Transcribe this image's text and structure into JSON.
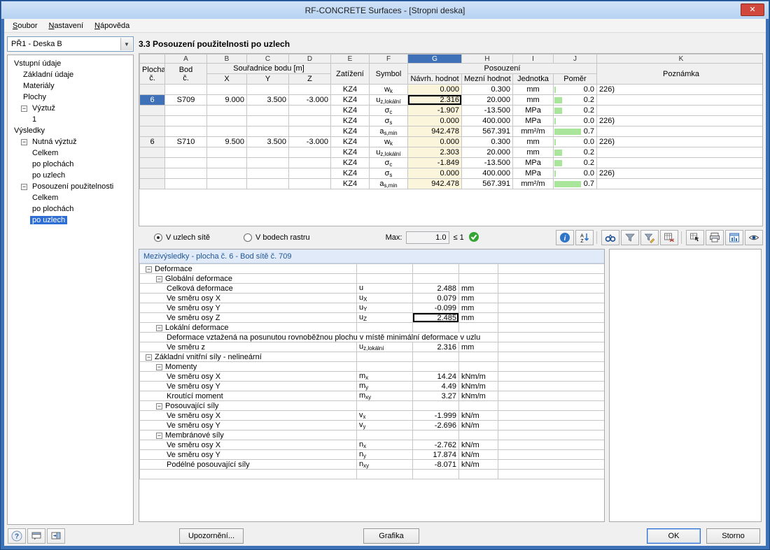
{
  "window": {
    "title": "RF-CONCRETE Surfaces - [Stropni deska]",
    "close_glyph": "✕"
  },
  "menu": {
    "items": [
      "Soubor",
      "Nastavení",
      "Nápověda"
    ]
  },
  "sidebar": {
    "combo_value": "PŘ1 - Deska B",
    "tree": [
      {
        "label": "Vstupní údaje",
        "indent": 0
      },
      {
        "label": "Základní údaje",
        "indent": 1
      },
      {
        "label": "Materiály",
        "indent": 1
      },
      {
        "label": "Plochy",
        "indent": 1
      },
      {
        "label": "Výztuž",
        "indent": 1,
        "exp": true
      },
      {
        "label": "1",
        "indent": 2
      },
      {
        "label": "Výsledky",
        "indent": 0
      },
      {
        "label": "Nutná výztuž",
        "indent": 1,
        "exp": true
      },
      {
        "label": "Celkem",
        "indent": 2
      },
      {
        "label": "po plochách",
        "indent": 2
      },
      {
        "label": "po uzlech",
        "indent": 2
      },
      {
        "label": "Posouzení použitelnosti",
        "indent": 1,
        "exp": true
      },
      {
        "label": "Celkem",
        "indent": 2
      },
      {
        "label": "po plochách",
        "indent": 2
      },
      {
        "label": "po uzlech",
        "indent": 2,
        "selected": true
      }
    ]
  },
  "main": {
    "section_title": "3.3 Posouzení použitelnosti po uzlech",
    "table": {
      "letters": [
        "A",
        "B",
        "C",
        "D",
        "E",
        "F",
        "G",
        "H",
        "I",
        "J",
        "K"
      ],
      "h": {
        "plocha1": "Plocha",
        "plocha2": "č.",
        "bod1": "Bod",
        "bod2": "č.",
        "coords": "Souřadnice bodu [m]",
        "x": "X",
        "y": "Y",
        "z": "Z",
        "zatizeni": "Zatížení",
        "symbol": "Symbol",
        "posouzeni": "Posouzení",
        "navrh": "Návrh. hodnot",
        "mezni": "Mezní hodnot",
        "jednotka": "Jednotka",
        "pomer": "Poměr",
        "poznamka": "Poznámka"
      },
      "rows": [
        {
          "plocha": "",
          "bod": "",
          "x": "",
          "y": "",
          "z": "",
          "kz": "KZ4",
          "sym": "w",
          "sub": "k",
          "navrh": "0.000",
          "mezni": "0.300",
          "unit": "mm",
          "pomer": "0.0",
          "ratio": 0.0,
          "note": "226)"
        },
        {
          "plocha": "6",
          "bod": "S709",
          "x": "9.000",
          "y": "3.500",
          "z": "-3.000",
          "kz": "KZ4",
          "sym": "u",
          "sub": "z,lokální",
          "navrh": "2.316",
          "mezni": "20.000",
          "unit": "mm",
          "pomer": "0.2",
          "ratio": 0.2,
          "note": "",
          "row_sel": true,
          "cell_sel": true
        },
        {
          "plocha": "",
          "bod": "",
          "x": "",
          "y": "",
          "z": "",
          "kz": "KZ4",
          "sym": "σ",
          "sub": "c",
          "navrh": "-1.907",
          "mezni": "-13.500",
          "unit": "MPa",
          "pomer": "0.2",
          "ratio": 0.2,
          "note": ""
        },
        {
          "plocha": "",
          "bod": "",
          "x": "",
          "y": "",
          "z": "",
          "kz": "KZ4",
          "sym": "σ",
          "sub": "s",
          "navrh": "0.000",
          "mezni": "400.000",
          "unit": "MPa",
          "pomer": "0.0",
          "ratio": 0.0,
          "note": "226)"
        },
        {
          "plocha": "",
          "bod": "",
          "x": "",
          "y": "",
          "z": "",
          "kz": "KZ4",
          "sym": "a",
          "sub": "s,min",
          "navrh": "942.478",
          "mezni": "567.391",
          "unit": "mm²/m",
          "pomer": "0.7",
          "ratio": 0.7,
          "note": ""
        },
        {
          "plocha": "6",
          "bod": "S710",
          "x": "9.500",
          "y": "3.500",
          "z": "-3.000",
          "kz": "KZ4",
          "sym": "w",
          "sub": "k",
          "navrh": "0.000",
          "mezni": "0.300",
          "unit": "mm",
          "pomer": "0.0",
          "ratio": 0.0,
          "note": "226)"
        },
        {
          "plocha": "",
          "bod": "",
          "x": "",
          "y": "",
          "z": "",
          "kz": "KZ4",
          "sym": "u",
          "sub": "z,lokální",
          "navrh": "2.303",
          "mezni": "20.000",
          "unit": "mm",
          "pomer": "0.2",
          "ratio": 0.2,
          "note": ""
        },
        {
          "plocha": "",
          "bod": "",
          "x": "",
          "y": "",
          "z": "",
          "kz": "KZ4",
          "sym": "σ",
          "sub": "c",
          "navrh": "-1.849",
          "mezni": "-13.500",
          "unit": "MPa",
          "pomer": "0.2",
          "ratio": 0.2,
          "note": ""
        },
        {
          "plocha": "",
          "bod": "",
          "x": "",
          "y": "",
          "z": "",
          "kz": "KZ4",
          "sym": "σ",
          "sub": "s",
          "navrh": "0.000",
          "mezni": "400.000",
          "unit": "MPa",
          "pomer": "0.0",
          "ratio": 0.0,
          "note": "226)"
        },
        {
          "plocha": "",
          "bod": "",
          "x": "",
          "y": "",
          "z": "",
          "kz": "KZ4",
          "sym": "a",
          "sub": "s,min",
          "navrh": "942.478",
          "mezni": "567.391",
          "unit": "mm²/m",
          "pomer": "0.7",
          "ratio": 0.7,
          "note": ""
        }
      ]
    },
    "controls": {
      "radio_mesh": "V uzlech sítě",
      "radio_grid": "V bodech rastru",
      "max_label": "Max:",
      "max_value": "1.0",
      "max_cond": "≤ 1"
    },
    "details": {
      "header": "Mezivýsledky  -  plocha č. 6 - Bod sítě č. 709",
      "rows": [
        {
          "t": "g",
          "i": 0,
          "label": "Deformace"
        },
        {
          "t": "g",
          "i": 1,
          "label": "Globální deformace"
        },
        {
          "t": "d",
          "i": 2,
          "label": "Celková deformace",
          "sym": "u",
          "sub": "",
          "val": "2.488",
          "unit": "mm"
        },
        {
          "t": "d",
          "i": 2,
          "label": "Ve směru osy X",
          "sym": "u",
          "sub": "X",
          "val": "0.079",
          "unit": "mm"
        },
        {
          "t": "d",
          "i": 2,
          "label": "Ve směru osy Y",
          "sym": "u",
          "sub": "Y",
          "val": "-0.099",
          "unit": "mm"
        },
        {
          "t": "d",
          "i": 2,
          "label": "Ve směru osy Z",
          "sym": "u",
          "sub": "Z",
          "val": "2.485",
          "unit": "mm",
          "sel": true
        },
        {
          "t": "g",
          "i": 1,
          "label": "Lokální deformace"
        },
        {
          "t": "x",
          "i": 2,
          "label": "Deformace vztažená na posunutou rovnoběžnou plochu v místě minimální deformace v uzlu"
        },
        {
          "t": "d",
          "i": 2,
          "label": "Ve směru z",
          "sym": "u",
          "sub": "z,lokální",
          "val": "2.316",
          "unit": "mm"
        },
        {
          "t": "g",
          "i": 0,
          "label": "Základní vnitřní síly - nelineární"
        },
        {
          "t": "g",
          "i": 1,
          "label": "Momenty"
        },
        {
          "t": "d",
          "i": 2,
          "label": "Ve směru osy X",
          "sym": "m",
          "sub": "x",
          "val": "14.24",
          "unit": "kNm/m"
        },
        {
          "t": "d",
          "i": 2,
          "label": "Ve směru osy Y",
          "sym": "m",
          "sub": "y",
          "val": "4.49",
          "unit": "kNm/m"
        },
        {
          "t": "d",
          "i": 2,
          "label": "Kroutící moment",
          "sym": "m",
          "sub": "xy",
          "val": "3.27",
          "unit": "kNm/m"
        },
        {
          "t": "g",
          "i": 1,
          "label": "Posouvající síly"
        },
        {
          "t": "d",
          "i": 2,
          "label": "Ve směru osy X",
          "sym": "v",
          "sub": "x",
          "val": "-1.999",
          "unit": "kN/m"
        },
        {
          "t": "d",
          "i": 2,
          "label": "Ve směru osy Y",
          "sym": "v",
          "sub": "y",
          "val": "-2.696",
          "unit": "kN/m"
        },
        {
          "t": "g",
          "i": 1,
          "label": "Membránové síly"
        },
        {
          "t": "d",
          "i": 2,
          "label": "Ve směru osy X",
          "sym": "n",
          "sub": "x",
          "val": "-2.762",
          "unit": "kN/m"
        },
        {
          "t": "d",
          "i": 2,
          "label": "Ve směru osy Y",
          "sym": "n",
          "sub": "y",
          "val": "17.874",
          "unit": "kN/m"
        },
        {
          "t": "d",
          "i": 2,
          "label": "Podélné posouvající síly",
          "sym": "n",
          "sub": "xy",
          "val": "-8.071",
          "unit": "kN/m"
        },
        {
          "t": "e"
        }
      ]
    }
  },
  "toolbar": {
    "icons": [
      "info",
      "sort-az",
      "find",
      "filter",
      "filter-edit",
      "recalculate",
      "pick-in-table",
      "print",
      "result-diagrams",
      "view"
    ]
  },
  "footer": {
    "upozorneni": "Upozornění...",
    "grafika": "Grafika",
    "ok": "OK",
    "storno": "Storno"
  },
  "colors": {
    "frame": "#3e72b8",
    "selection": "#2f6fd4",
    "g_column": "#fbf5dc",
    "ratio_bar": "#a9e69b",
    "check_green": "#35a435",
    "close_red": "#d0493c"
  }
}
